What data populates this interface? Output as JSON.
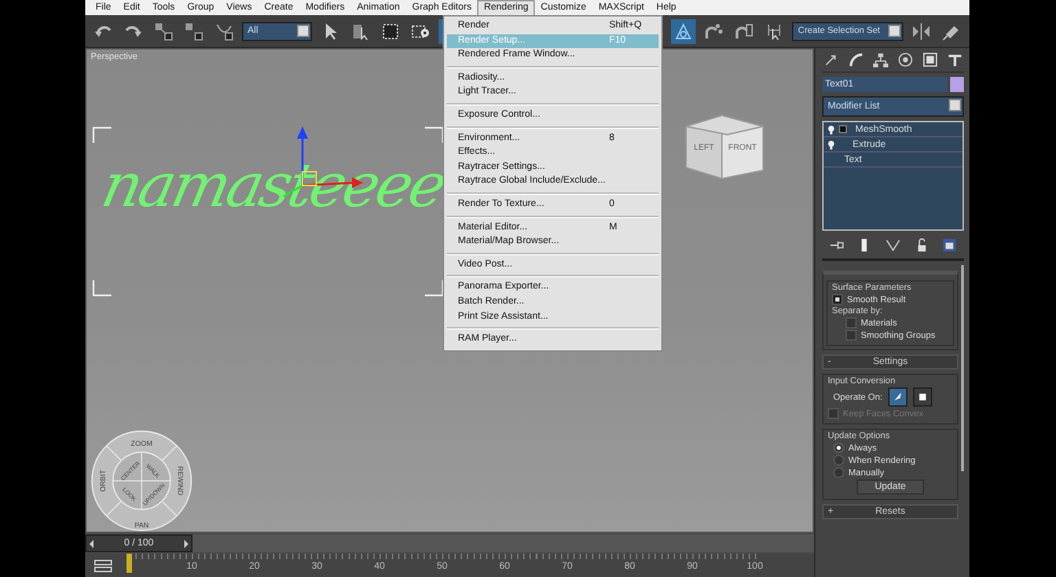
{
  "menu_bar": [
    {
      "label": "File",
      "selected": false
    },
    {
      "label": "Edit",
      "selected": false
    },
    {
      "label": "Tools",
      "selected": false
    },
    {
      "label": "Group",
      "selected": false
    },
    {
      "label": "Views",
      "selected": false
    },
    {
      "label": "Create",
      "selected": false
    },
    {
      "label": "Modifiers",
      "selected": false
    },
    {
      "label": "Animation",
      "selected": false
    },
    {
      "label": "Graph Editors",
      "selected": false
    },
    {
      "label": "Rendering",
      "selected": true
    },
    {
      "label": "Customize",
      "selected": false
    },
    {
      "label": "MAXScript",
      "selected": false
    },
    {
      "label": "Help",
      "selected": false
    }
  ],
  "toolbar": {
    "filter": "All",
    "selection_set": "Create Selection Set"
  },
  "viewport": {
    "label": "Perspective",
    "scene_text": "namasteeee",
    "viewcube_faces": [
      "LEFT",
      "FRONT"
    ],
    "nav_wheel": {
      "outer": [
        "ZOOM",
        "ORBIT",
        "REWIND",
        "PAN"
      ],
      "inner": [
        "CENTER",
        "WALK",
        "LOOK",
        "UP/DOWN"
      ]
    }
  },
  "rendering_menu": [
    [
      {
        "label": "Render",
        "shortcut": "Shift+Q",
        "selected": false
      },
      {
        "label": "Render Setup...",
        "shortcut": "F10",
        "selected": true
      },
      {
        "label": "Rendered Frame Window...",
        "selected": false
      }
    ],
    [
      {
        "label": "Radiosity...",
        "selected": false
      },
      {
        "label": "Light Tracer...",
        "selected": false
      }
    ],
    [
      {
        "label": "Exposure Control...",
        "selected": false
      }
    ],
    [
      {
        "label": "Environment...",
        "shortcut": "8",
        "selected": false
      },
      {
        "label": "Effects...",
        "selected": false
      },
      {
        "label": "Raytracer Settings...",
        "selected": false
      },
      {
        "label": "Raytrace Global Include/Exclude...",
        "selected": false
      }
    ],
    [
      {
        "label": "Render To Texture...",
        "shortcut": "0",
        "selected": false
      }
    ],
    [
      {
        "label": "Material Editor...",
        "shortcut": "M",
        "selected": false
      },
      {
        "label": "Material/Map Browser...",
        "selected": false
      }
    ],
    [
      {
        "label": "Video Post...",
        "selected": false
      }
    ],
    [
      {
        "label": "Panorama Exporter...",
        "selected": false
      },
      {
        "label": "Batch Render...",
        "selected": false
      },
      {
        "label": "Print Size Assistant...",
        "selected": false
      }
    ],
    [
      {
        "label": "RAM Player...",
        "selected": false
      }
    ]
  ],
  "command_panel": {
    "object_name": "Text01",
    "modifier_list": "Modifier List",
    "stack": [
      {
        "label": "MeshSmooth",
        "kind": "group"
      },
      {
        "label": "Extrude",
        "kind": "modifier"
      },
      {
        "label": "Text",
        "kind": "base"
      }
    ],
    "surface_parameters": {
      "title": "Surface Parameters",
      "smooth_result": {
        "label": "Smooth Result",
        "checked": true
      },
      "separate_by": "Separate by:",
      "options": [
        {
          "label": "Materials",
          "checked": false
        },
        {
          "label": "Smoothing Groups",
          "checked": false
        }
      ]
    },
    "settings": {
      "sign": "-",
      "title": "Settings",
      "input_conversion": "Input Conversion",
      "operate_on": "Operate On:",
      "modes": [
        {
          "kind": "polygon",
          "selected": true
        },
        {
          "kind": "face",
          "selected": false
        }
      ],
      "keep_faces_convex": {
        "label": "Keep Faces Convex",
        "checked": false,
        "disabled": true
      },
      "update_options": "Update Options",
      "choices": [
        {
          "label": "Always",
          "selected": true
        },
        {
          "label": "When Rendering",
          "selected": false
        },
        {
          "label": "Manually",
          "selected": false
        }
      ],
      "update_button": "Update"
    },
    "resets": {
      "sign": "+",
      "title": "Resets"
    }
  },
  "timeline": {
    "frame": "0 / 100",
    "level": 0,
    "ticks": [
      "10",
      "20",
      "30",
      "40",
      "50",
      "60",
      "70",
      "80",
      "90",
      "100"
    ]
  }
}
